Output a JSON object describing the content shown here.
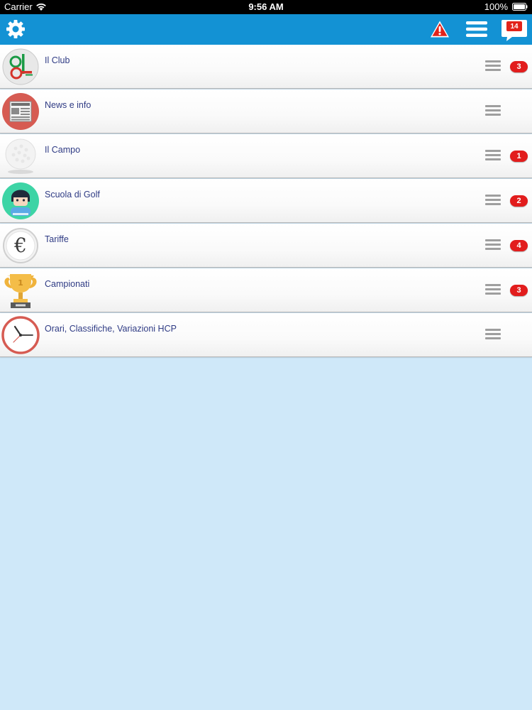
{
  "status_bar": {
    "carrier": "Carrier",
    "time": "9:56 AM",
    "battery": "100%"
  },
  "toolbar": {
    "background": "#1392d4",
    "settings_icon": "gear-icon",
    "alert_icon": "warning-triangle-icon",
    "menu_icon": "hamburger-menu-icon",
    "messages_icon": "chat-bubble-icon",
    "messages_count": "14"
  },
  "list": {
    "items": [
      {
        "label": "Il Club",
        "icon": "club-logo-icon",
        "badge": "3"
      },
      {
        "label": "News e info",
        "icon": "newspaper-icon",
        "badge": ""
      },
      {
        "label": "Il Campo",
        "icon": "golf-ball-icon",
        "badge": "1"
      },
      {
        "label": "Scuola di Golf",
        "icon": "student-avatar-icon",
        "badge": "2"
      },
      {
        "label": "Tariffe",
        "icon": "euro-coin-icon",
        "badge": "4"
      },
      {
        "label": "Campionati",
        "icon": "trophy-icon",
        "badge": "3"
      },
      {
        "label": "Orari, Classifiche, Variazioni HCP",
        "icon": "clock-icon",
        "badge": ""
      }
    ]
  }
}
